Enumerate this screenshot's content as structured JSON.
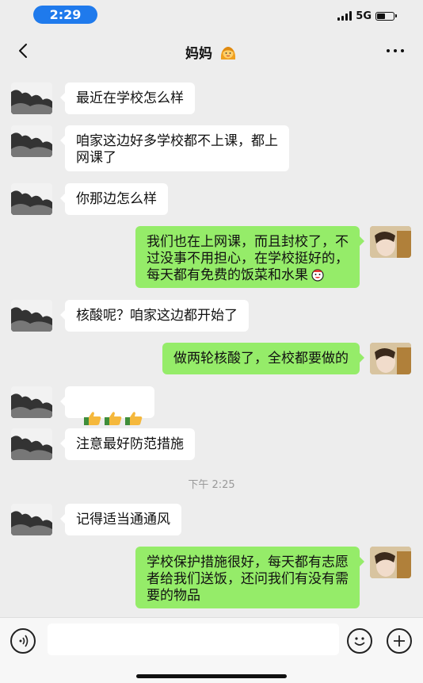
{
  "status_bar": {
    "time": "2:29",
    "network": "5G",
    "battery_level": 0.5
  },
  "nav": {
    "title": "妈妈"
  },
  "messages": [
    {
      "side": "left",
      "text": "最近在学校怎么样"
    },
    {
      "side": "left",
      "text": "咱家这边好多学校都不上课，都上\n网课了"
    },
    {
      "side": "left",
      "text": "你那边怎么样"
    },
    {
      "side": "right",
      "text": "我们也在上网课，而且封校了，不\n过没事不用担心，在学校挺好的，\n每天都有免费的饭菜和水果"
    },
    {
      "side": "left",
      "text": "核酸呢？咱家这边都开始了"
    },
    {
      "side": "right",
      "text": "做两轮核酸了，全校都要做的"
    },
    {
      "side": "left",
      "emoji": "thumbs-up x3"
    },
    {
      "side": "left",
      "text": "注意最好防范措施"
    },
    {
      "side": "left",
      "text": "记得适当通通风"
    },
    {
      "side": "right",
      "text": "学校保护措施很好，每天都有志愿\n者给我们送饭，还问我们有没有需\n要的物品"
    }
  ],
  "timestamp": "下午 2:25",
  "input": {
    "value": "",
    "placeholder": ""
  },
  "colors": {
    "accent": "#95ec69",
    "status_pill": "#1f7aec",
    "background": "#ededed"
  }
}
